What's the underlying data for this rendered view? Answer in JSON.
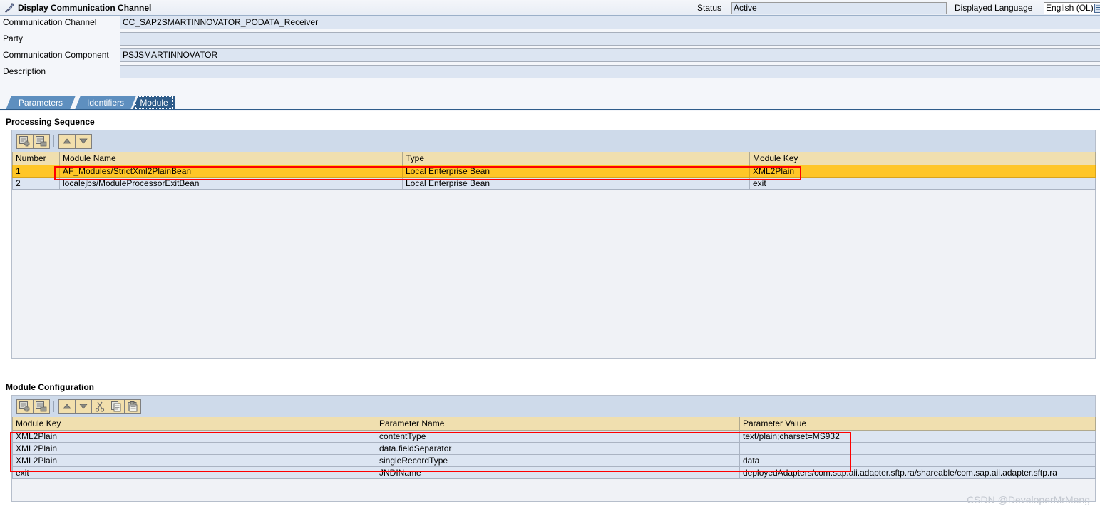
{
  "window": {
    "title": "Display Communication Channel",
    "title_icon": "plug-connector-icon"
  },
  "header": {
    "status_label": "Status",
    "status_value": "Active",
    "language_label": "Displayed Language",
    "language_value": "English (OL)",
    "language_dropdown_icon": "dropdown-list-icon"
  },
  "form": {
    "fields": [
      {
        "label": "Communication Channel",
        "value": "CC_SAP2SMARTINNOVATOR_PODATA_Receiver"
      },
      {
        "label": "Party",
        "value": ""
      },
      {
        "label": "Communication Component",
        "value": "PSJSMARTINNOVATOR"
      },
      {
        "label": "Description",
        "value": ""
      }
    ]
  },
  "tabs": [
    {
      "label": "Parameters",
      "active": false
    },
    {
      "label": "Identifiers",
      "active": false
    },
    {
      "label": "Module",
      "active": true
    }
  ],
  "processing_sequence": {
    "heading": "Processing Sequence",
    "toolbar": [
      {
        "name": "insert-row-button",
        "icon": "insert-row-icon"
      },
      {
        "name": "delete-row-button",
        "icon": "delete-row-icon"
      },
      {
        "name": "move-up-button",
        "icon": "arrow-up-icon"
      },
      {
        "name": "move-down-button",
        "icon": "arrow-down-icon"
      }
    ],
    "columns": [
      "Number",
      "Module Name",
      "Type",
      "Module Key"
    ],
    "rows": [
      {
        "number": "1",
        "module_name": "AF_Modules/StrictXml2PlainBean",
        "type": "Local Enterprise Bean",
        "module_key": "XML2Plain",
        "selected": true
      },
      {
        "number": "2",
        "module_name": "localejbs/ModuleProcessorExitBean",
        "type": "Local Enterprise Bean",
        "module_key": "exit",
        "selected": false
      }
    ]
  },
  "module_configuration": {
    "heading": "Module Configuration",
    "toolbar": [
      {
        "name": "insert-row-button",
        "icon": "insert-row-icon"
      },
      {
        "name": "delete-row-button",
        "icon": "delete-row-icon"
      },
      {
        "name": "move-up-button",
        "icon": "arrow-up-icon"
      },
      {
        "name": "move-down-button",
        "icon": "arrow-down-icon"
      },
      {
        "name": "cut-button",
        "icon": "scissors-icon"
      },
      {
        "name": "copy-button",
        "icon": "copy-icon"
      },
      {
        "name": "paste-button",
        "icon": "paste-icon"
      }
    ],
    "columns": [
      "Module Key",
      "Parameter Name",
      "Parameter Value"
    ],
    "rows": [
      {
        "module_key": "XML2Plain",
        "parameter_name": "contentType",
        "parameter_value": "text/plain;charset=MS932"
      },
      {
        "module_key": "XML2Plain",
        "parameter_name": "data.fieldSeparator",
        "parameter_value": ""
      },
      {
        "module_key": "XML2Plain",
        "parameter_name": "singleRecordType",
        "parameter_value": "data"
      },
      {
        "module_key": "exit",
        "parameter_name": "JNDIName",
        "parameter_value": "deployedAdapters/com.sap.aii.adapter.sftp.ra/shareable/com.sap.aii.adapter.sftp.ra"
      }
    ]
  },
  "watermark": "CSDN @DeveloperMrMeng",
  "colors": {
    "selected_row": "#FFC627",
    "table_header": "#F0DFAF",
    "row_background": "#DCE5F2",
    "annotation": "#FF0000",
    "tab_active": "#2E5C8A",
    "tab_inactive": "#5E8FBF"
  }
}
